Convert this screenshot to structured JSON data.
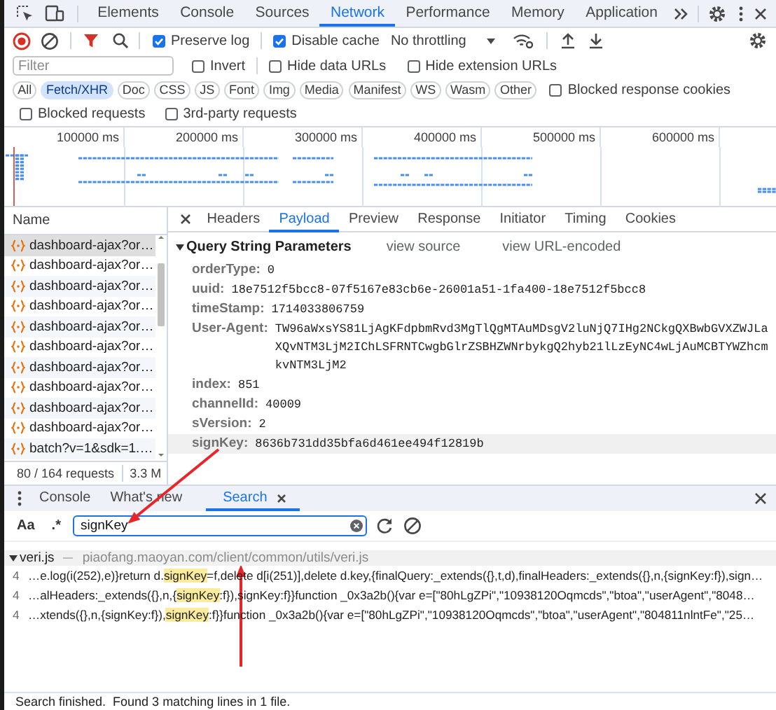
{
  "main_tabs": [
    {
      "label": "Elements",
      "selected": false
    },
    {
      "label": "Console",
      "selected": false
    },
    {
      "label": "Sources",
      "selected": false
    },
    {
      "label": "Network",
      "selected": true
    },
    {
      "label": "Performance",
      "selected": false
    },
    {
      "label": "Memory",
      "selected": false
    },
    {
      "label": "Application",
      "selected": false
    }
  ],
  "toolbar": {
    "preserve_log": {
      "label": "Preserve log",
      "checked": true
    },
    "disable_cache": {
      "label": "Disable cache",
      "checked": true
    },
    "throttling": "No throttling"
  },
  "filter": {
    "placeholder": "Filter",
    "options": [
      {
        "label": "Invert",
        "checked": false
      },
      {
        "label": "Hide data URLs",
        "checked": false
      },
      {
        "label": "Hide extension URLs",
        "checked": false
      }
    ]
  },
  "type_filters": [
    {
      "label": "All",
      "selected": false
    },
    {
      "label": "Fetch/XHR",
      "selected": true
    },
    {
      "label": "Doc",
      "selected": false
    },
    {
      "label": "CSS",
      "selected": false
    },
    {
      "label": "JS",
      "selected": false
    },
    {
      "label": "Font",
      "selected": false
    },
    {
      "label": "Img",
      "selected": false
    },
    {
      "label": "Media",
      "selected": false
    },
    {
      "label": "Manifest",
      "selected": false
    },
    {
      "label": "WS",
      "selected": false
    },
    {
      "label": "Wasm",
      "selected": false
    },
    {
      "label": "Other",
      "selected": false
    }
  ],
  "blocked_response_cookies": {
    "label": "Blocked response cookies",
    "checked": false
  },
  "request_options": [
    {
      "label": "Blocked requests",
      "checked": false
    },
    {
      "label": "3rd-party requests",
      "checked": false
    }
  ],
  "timeline": {
    "ticks": [
      "100000 ms",
      "200000 ms",
      "300000 ms",
      "400000 ms",
      "500000 ms",
      "600000 ms"
    ]
  },
  "requests": {
    "column": "Name",
    "rows": [
      {
        "name": "dashboard-ajax?or…",
        "selected": true
      },
      {
        "name": "dashboard-ajax?or…",
        "selected": false
      },
      {
        "name": "dashboard-ajax?or…",
        "selected": false
      },
      {
        "name": "dashboard-ajax?or…",
        "selected": false
      },
      {
        "name": "dashboard-ajax?or…",
        "selected": false
      },
      {
        "name": "dashboard-ajax?or…",
        "selected": false
      },
      {
        "name": "dashboard-ajax?or…",
        "selected": false
      },
      {
        "name": "dashboard-ajax?or…",
        "selected": false
      },
      {
        "name": "dashboard-ajax?or…",
        "selected": false
      },
      {
        "name": "dashboard-ajax?or…",
        "selected": false
      },
      {
        "name": "batch?v=1&sdk=1.…",
        "selected": false
      }
    ],
    "summary": "80 / 164 requests",
    "transferred": "3.3 M"
  },
  "detail_tabs": [
    {
      "label": "Headers",
      "selected": false
    },
    {
      "label": "Payload",
      "selected": true
    },
    {
      "label": "Preview",
      "selected": false
    },
    {
      "label": "Response",
      "selected": false
    },
    {
      "label": "Initiator",
      "selected": false
    },
    {
      "label": "Timing",
      "selected": false
    },
    {
      "label": "Cookies",
      "selected": false
    }
  ],
  "payload": {
    "section": "Query String Parameters",
    "expanded": true,
    "links": [
      "view source",
      "view URL-encoded"
    ],
    "params": [
      {
        "key": "orderType:",
        "value": "0",
        "highlighted": false
      },
      {
        "key": "uuid:",
        "value": "18e7512f5bcc8-07f5167e83cb6e-26001a51-1fa400-18e7512f5bcc8",
        "highlighted": false
      },
      {
        "key": "timeStamp:",
        "value": "1714033806759",
        "highlighted": false
      },
      {
        "key": "User-Agent:",
        "value": "TW96aWxsYS81LjAgKFdpbmRvd3MgTlQgMTAuMDsgV2luNjQ7IHg2NCkgQXBwbGVXZWJLaXQvNTM3LjM2IChLSFRNTCwgbGlrZSBHZWNrbykgQ2hyb21lLzEyNC4wLjAuMCBTYWZhcmkvNTM3LjM2",
        "highlighted": false
      },
      {
        "key": "index:",
        "value": "851",
        "highlighted": false
      },
      {
        "key": "channelId:",
        "value": "40009",
        "highlighted": false
      },
      {
        "key": "sVersion:",
        "value": "2",
        "highlighted": false
      },
      {
        "key": "signKey:",
        "value": "8636b731dd35bfa6d461ee494f12819b",
        "highlighted": true
      }
    ]
  },
  "drawer": {
    "tabs": [
      {
        "label": "Console",
        "selected": false,
        "closable": false
      },
      {
        "label": "What's new",
        "selected": false,
        "closable": false
      },
      {
        "label": "Search",
        "selected": true,
        "closable": true
      }
    ],
    "search": {
      "match_case": "Aa",
      "regex": ".*",
      "value": "signKey"
    },
    "results": [
      {
        "file": "veri.js",
        "url": "piaofang.maoyan.com/client/common/utils/veri.js",
        "expanded": true,
        "lines": [
          {
            "line_number": "4",
            "parts": [
              {
                "text": "…e.log(i(252),e)}return d.",
                "match": false
              },
              {
                "text": "signKey",
                "match": true
              },
              {
                "text": "=f,delete d[i(251)],delete d.key,{finalQuery:_extends({},t,d),finalHeaders:_extends({},n,{signKey:f}),sign…",
                "match": false
              }
            ]
          },
          {
            "line_number": "4",
            "parts": [
              {
                "text": "…alHeaders:_extends({},n,{",
                "match": false
              },
              {
                "text": "signKey",
                "match": true
              },
              {
                "text": ":f}),signKey:f}}function _0x3a2b(){var e=[\"80hLgZPi\",\"10938120Oqmcds\",\"btoa\",\"userAgent\",\"8048…",
                "match": false
              }
            ]
          },
          {
            "line_number": "4",
            "parts": [
              {
                "text": "…xtends({},n,{signKey:f}),",
                "match": false
              },
              {
                "text": "signKey",
                "match": true
              },
              {
                "text": ":f}}function _0x3a2b(){var e=[\"80hLgZPi\",\"10938120Oqmcds\",\"btoa\",\"userAgent\",\"804811nlntFe\",\"25…",
                "match": false
              }
            ]
          }
        ]
      }
    ],
    "status": "Search finished.  Found 3 matching lines in 1 file."
  }
}
